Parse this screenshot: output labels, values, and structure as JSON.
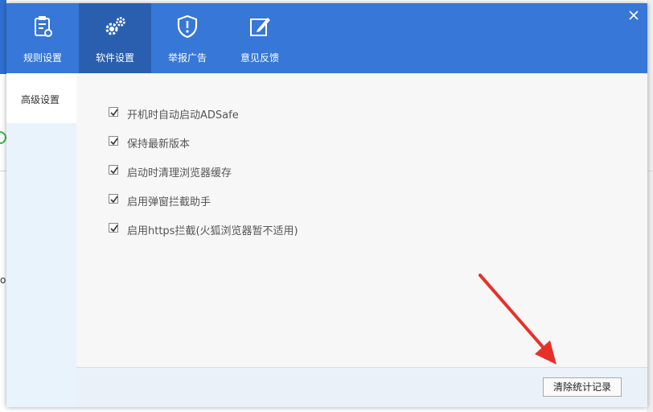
{
  "tabs": [
    {
      "label": "规则设置",
      "icon": "clipboard-icon"
    },
    {
      "label": "软件设置",
      "icon": "gears-icon"
    },
    {
      "label": "举报广告",
      "icon": "shield-alert-icon"
    },
    {
      "label": "意见反馈",
      "icon": "edit-icon"
    }
  ],
  "active_tab": "软件设置",
  "sidebar": {
    "items": [
      {
        "label": "高级设置"
      }
    ]
  },
  "options": [
    {
      "label": "开机时自动启动ADSafe",
      "checked": true
    },
    {
      "label": "保持最新版本",
      "checked": true
    },
    {
      "label": "启动时清理浏览器缓存",
      "checked": true
    },
    {
      "label": "启用弹窗拦截助手",
      "checked": true
    },
    {
      "label": "启用https拦截(火狐浏览器暂不适用)",
      "checked": true
    }
  ],
  "footer": {
    "clear_button_label": "清除统计记录"
  },
  "colors": {
    "header": "#3677d7",
    "active_tab": "#2a5fb0",
    "sidebar": "#e8f3fc",
    "annotation_arrow": "#e8302a"
  }
}
